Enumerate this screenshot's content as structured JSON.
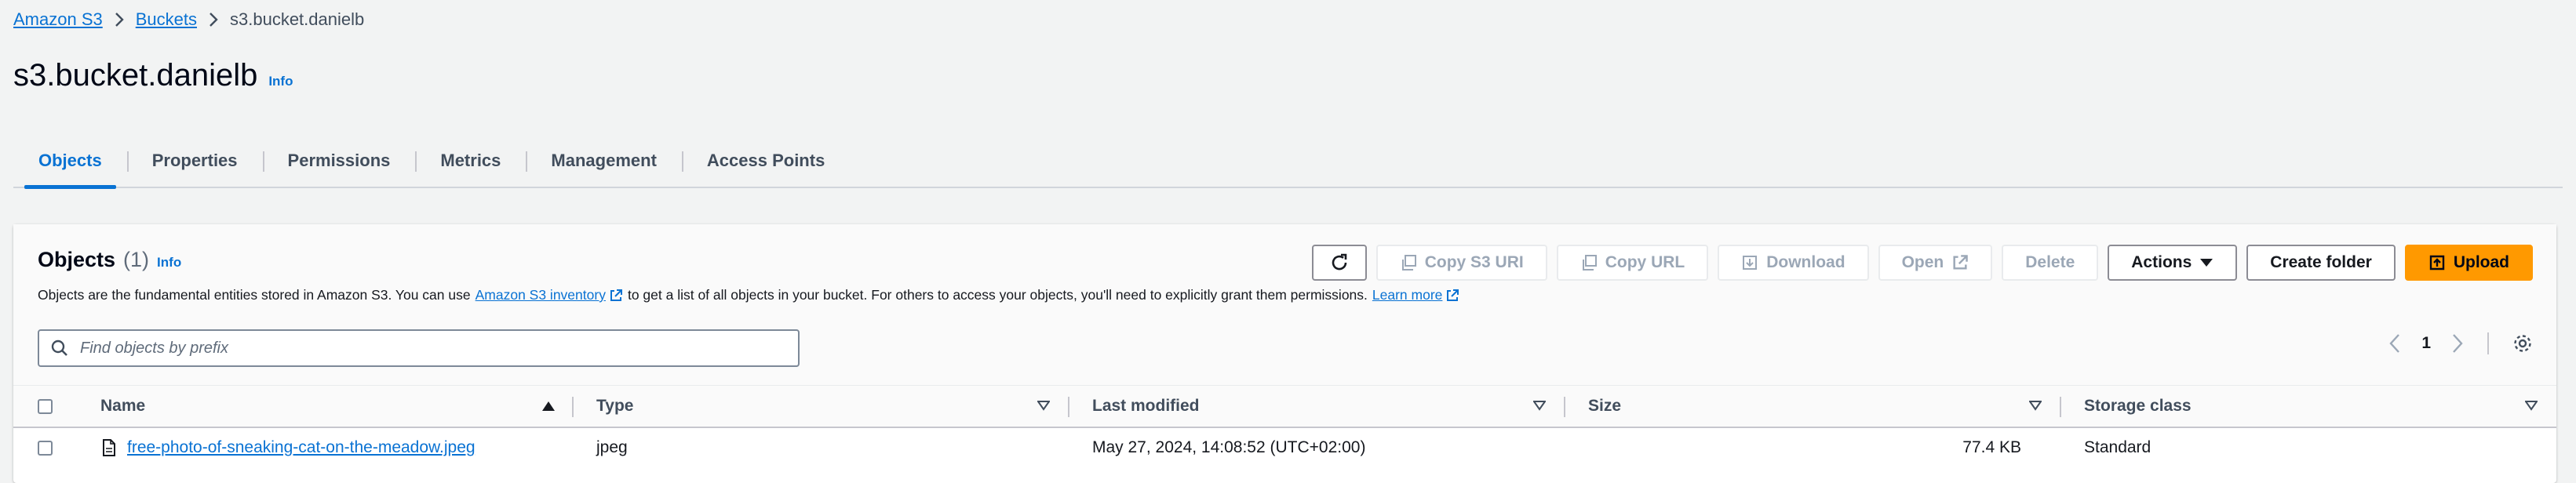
{
  "breadcrumb": {
    "items": [
      "Amazon S3",
      "Buckets"
    ],
    "current": "s3.bucket.danielb"
  },
  "page": {
    "title": "s3.bucket.danielb",
    "info": "Info"
  },
  "tabs": [
    "Objects",
    "Properties",
    "Permissions",
    "Metrics",
    "Management",
    "Access Points"
  ],
  "objects_panel": {
    "title": "Objects",
    "count": "(1)",
    "info": "Info",
    "description_prefix": "Objects are the fundamental entities stored in Amazon S3. You can use",
    "inventory_link": "Amazon S3 inventory",
    "description_middle": "to get a list of all objects in your bucket. For others to access your objects, you'll need to explicitly grant them permissions.",
    "learn_more": "Learn more",
    "buttons": {
      "copy_s3_uri": "Copy S3 URI",
      "copy_url": "Copy URL",
      "download": "Download",
      "open": "Open",
      "delete": "Delete",
      "actions": "Actions",
      "create_folder": "Create folder",
      "upload": "Upload"
    },
    "search": {
      "placeholder": "Find objects by prefix"
    },
    "pagination": {
      "page": "1"
    }
  },
  "table": {
    "columns": {
      "name": "Name",
      "type": "Type",
      "last_modified": "Last modified",
      "size": "Size",
      "storage_class": "Storage class"
    },
    "rows": [
      {
        "name": "free-photo-of-sneaking-cat-on-the-meadow.jpeg",
        "type": "jpeg",
        "last_modified": "May 27, 2024, 14:08:52 (UTC+02:00)",
        "size": "77.4 KB",
        "storage_class": "Standard"
      }
    ]
  },
  "colors": {
    "link": "#0972d3",
    "primary_button": "#ff9900",
    "background": "#f2f3f3"
  }
}
